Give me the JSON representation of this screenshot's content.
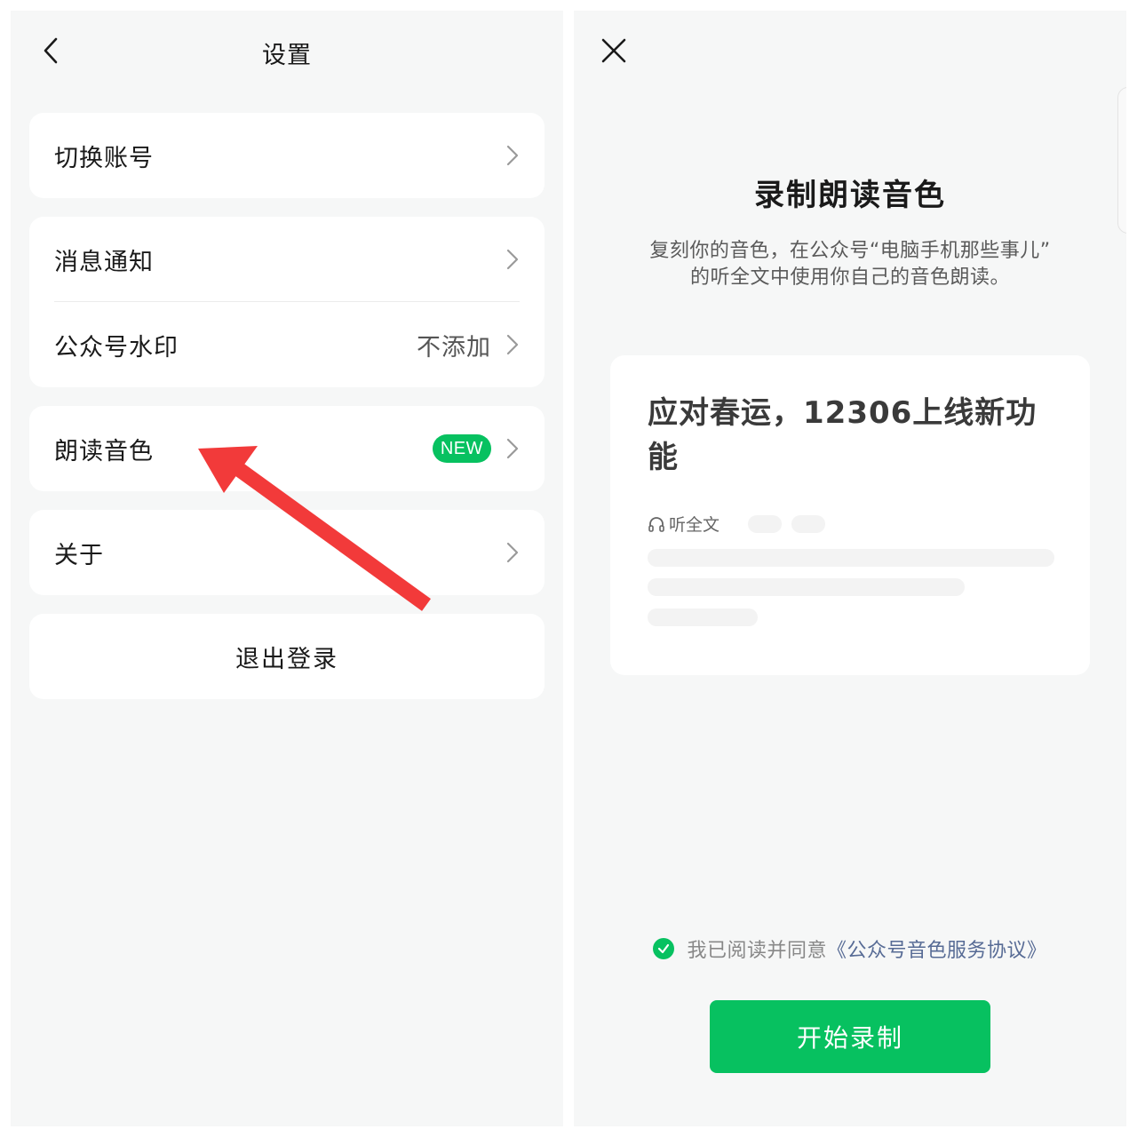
{
  "settings": {
    "title": "设置",
    "items": {
      "switch_account": {
        "label": "切换账号"
      },
      "notifications": {
        "label": "消息通知"
      },
      "watermark": {
        "label": "公众号水印",
        "value": "不添加"
      },
      "voice": {
        "label": "朗读音色",
        "badge": "NEW"
      },
      "about": {
        "label": "关于"
      }
    },
    "logout_label": "退出登录"
  },
  "record": {
    "title": "录制朗读音色",
    "desc_line1": "复刻你的音色，在公众号“电脑手机那些事儿”",
    "desc_line2": "的听全文中使用你自己的音色朗读。",
    "sample": {
      "article_title": "应对春运，12306上线新功能",
      "listen_label": "听全文"
    },
    "agree_text": "我已阅读并同意",
    "agree_link": "《公众号音色服务协议》",
    "agree_checked": true,
    "start_button": "开始录制"
  },
  "colors": {
    "brand_green": "#07c160",
    "link_blue": "#576b95",
    "annotation_arrow": "#f23a3a",
    "background": "#f6f7f7"
  },
  "icons": {
    "back": "chevron-left-icon",
    "row_arrow": "chevron-right-icon",
    "close": "close-icon",
    "headphones": "headphones-icon",
    "check": "check-icon"
  }
}
